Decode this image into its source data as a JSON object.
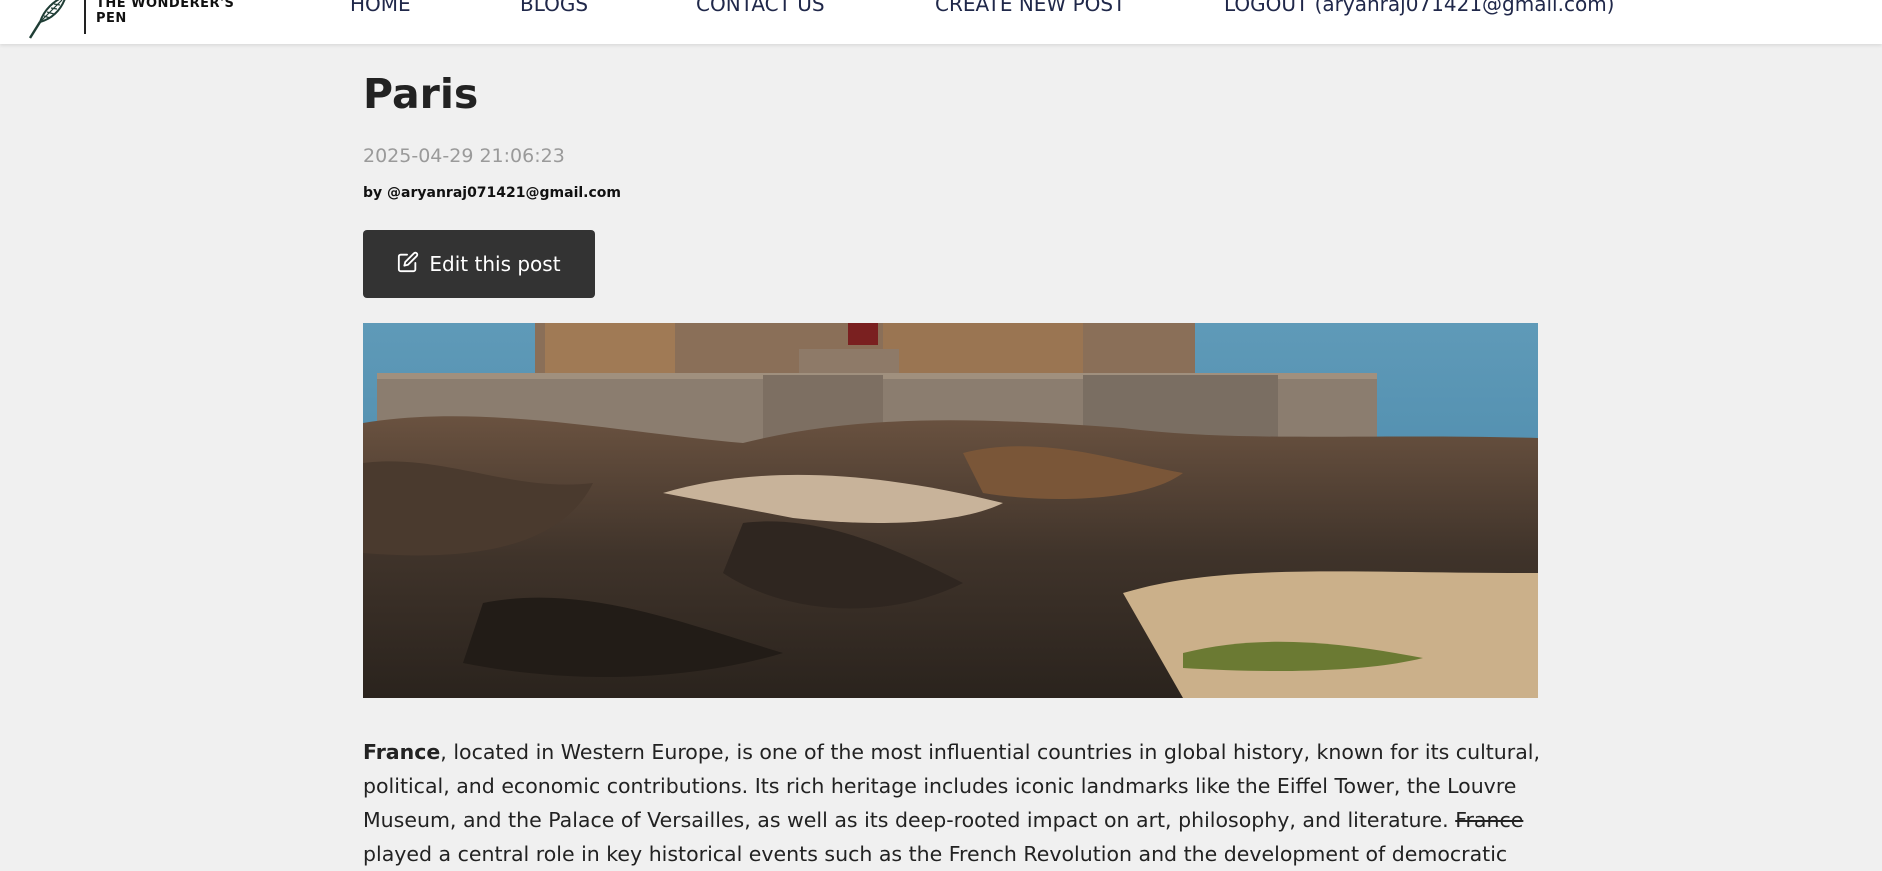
{
  "brand": {
    "name": "THE WONDERER'S PEN",
    "logo_icon": "feather-quill-icon"
  },
  "nav": {
    "home": "HOME",
    "blogs": "BLOGS",
    "contact": "CONTACT US",
    "create": "CREATE NEW POST",
    "logout": "LOGOUT (aryanraj071421@gmail.com)"
  },
  "post": {
    "title": "Paris",
    "date": "2025-04-29 21:06:23",
    "author": "by @aryanraj071421@gmail.com",
    "edit_label": "Edit this post",
    "edit_icon": "edit-icon",
    "image_alt": "Fort National on rocky coast with sea and beach",
    "body": {
      "bold": "France",
      "p1": ", located in Western Europe, is one of the most influential countries in global history, known for its cultural, political, and economic contributions. Its rich heritage includes iconic landmarks like the Eiffel Tower, the Louvre Museum, and the Palace of Versailles, as well as its deep-rooted impact on art, philosophy, and literature. ",
      "strike": "France",
      "p2": " played a central role in key historical events such as the French Revolution and the development of democratic"
    }
  },
  "colors": {
    "nav_text": "#20284a",
    "button_bg": "#333333",
    "page_bg": "#f0f0f0",
    "date_text": "#9a9a9a"
  }
}
